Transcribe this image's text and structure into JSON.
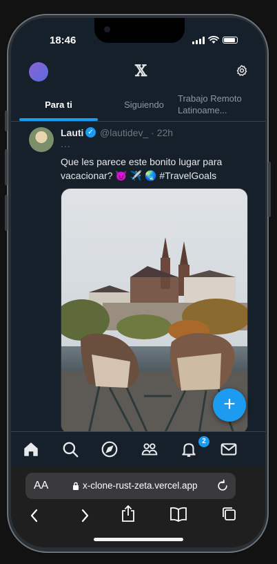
{
  "status_bar": {
    "time": "18:46"
  },
  "header": {
    "logo": "𝕏"
  },
  "tabs": [
    {
      "label": "Para ti"
    },
    {
      "label": "Siguiendo"
    },
    {
      "label_line1": "Trabajo Remoto",
      "label_line2": "Latinoame..."
    }
  ],
  "tweet": {
    "name": "Lauti",
    "handle": "@lautidev_ · 22h",
    "more": "...",
    "text": "Que les parece este bonito lugar para vacacionar? 😈 ✈️ 🌏 #TravelGoals"
  },
  "fab": {
    "label": "+"
  },
  "bottom_nav": {
    "items": [
      "home-icon",
      "search-icon",
      "explore-icon",
      "communities-icon",
      "notifications-icon",
      "messages-icon"
    ],
    "notification_count": "2"
  },
  "browser": {
    "text_size": "AA",
    "url": "x-clone-rust-zeta.vercel.app"
  },
  "colors": {
    "accent": "#1d9bf0",
    "background": "#15202b",
    "safari_bar": "#1f1f1f"
  }
}
